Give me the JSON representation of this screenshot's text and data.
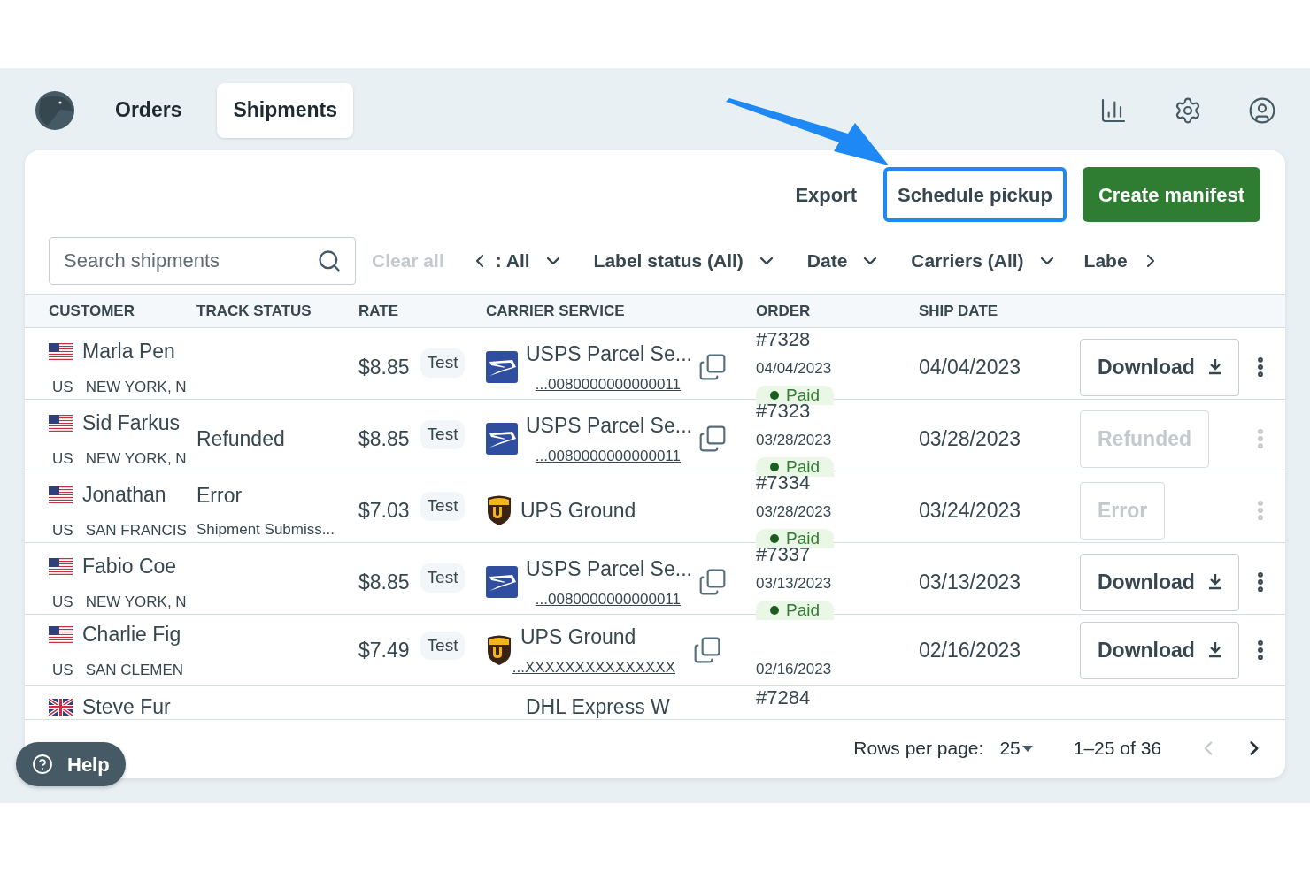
{
  "nav": {
    "tabs": [
      {
        "label": "Orders",
        "selected": false
      },
      {
        "label": "Shipments",
        "selected": true
      }
    ]
  },
  "toolbar": [
    {
      "label": "Export",
      "kind": "text",
      "highlighted": false
    },
    {
      "label": "Schedule pickup",
      "kind": "text",
      "highlighted": true
    },
    {
      "label": "Create manifest",
      "kind": "primary",
      "highlighted": false
    }
  ],
  "filters": {
    "search": {
      "placeholder": "Search shipments"
    },
    "clear_all": {
      "label": "Clear all",
      "disabled": true
    },
    "chips": [
      ": All",
      "Label status (All)",
      "Date",
      "Carriers (All)"
    ],
    "cut_chip": "Labe"
  },
  "table": {
    "columns": [
      "CUSTOMER",
      "TRACK STATUS",
      "RATE",
      "CARRIER SERVICE",
      "ORDER",
      "SHIP DATE"
    ],
    "rows": [
      {
        "flag": {
          "kind": "us"
        },
        "name": "Marla Pen",
        "country": "US",
        "city": "NEW YORK, N",
        "track_status": "",
        "track_detail": "",
        "rate": "$8.85",
        "rate_tag": "Test",
        "carrier": {
          "kind": "usps"
        },
        "service": "USPS Parcel Se...",
        "tracking": "...0080000000000011",
        "order": "#7328",
        "order_date": "04/04/2023",
        "payment": "Paid",
        "ship_date": "04/04/2023",
        "action": {
          "label": "Download",
          "disabled": false
        }
      },
      {
        "flag": {
          "kind": "us"
        },
        "name": "Sid Farkus",
        "country": "US",
        "city": "NEW YORK, N",
        "track_status": "Refunded",
        "track_detail": "",
        "rate": "$8.85",
        "rate_tag": "Test",
        "carrier": {
          "kind": "usps"
        },
        "service": "USPS Parcel Se...",
        "tracking": "...0080000000000011",
        "order": "#7323",
        "order_date": "03/28/2023",
        "payment": "Paid",
        "ship_date": "03/28/2023",
        "action": {
          "label": "Refunded",
          "disabled": true
        }
      },
      {
        "flag": {
          "kind": "us"
        },
        "name": "Jonathan",
        "country": "US",
        "city": "SAN FRANCIS",
        "track_status": "Error",
        "track_detail": "Shipment Submiss...",
        "rate": "$7.03",
        "rate_tag": "Test",
        "carrier": {
          "kind": "ups"
        },
        "service": "UPS Ground",
        "tracking": "",
        "order": "#7334",
        "order_date": "03/28/2023",
        "payment": "Paid",
        "ship_date": "03/24/2023",
        "action": {
          "label": "Error",
          "disabled": true
        }
      },
      {
        "flag": {
          "kind": "us"
        },
        "name": "Fabio Coe",
        "country": "US",
        "city": "NEW YORK, N",
        "track_status": "",
        "track_detail": "",
        "rate": "$8.85",
        "rate_tag": "Test",
        "carrier": {
          "kind": "usps"
        },
        "service": "USPS Parcel Se...",
        "tracking": "...0080000000000011",
        "order": "#7337",
        "order_date": "03/13/2023",
        "payment": "Paid",
        "ship_date": "03/13/2023",
        "action": {
          "label": "Download",
          "disabled": false
        }
      },
      {
        "flag": {
          "kind": "us"
        },
        "name": "Charlie Fig",
        "country": "US",
        "city": "SAN CLEMEN",
        "track_status": "",
        "track_detail": "",
        "rate": "$7.49",
        "rate_tag": "Test",
        "carrier": {
          "kind": "ups"
        },
        "service": "UPS Ground",
        "tracking": "...XXXXXXXXXXXXXXX",
        "order": "",
        "order_date": "02/16/2023",
        "payment": "",
        "ship_date": "02/16/2023",
        "action": {
          "label": "Download",
          "disabled": false
        }
      }
    ],
    "partial_row": {
      "flag": {
        "kind": "uk"
      },
      "name": "Steve Fur",
      "service": "DHL Express W",
      "order": "#7284"
    }
  },
  "pagination": {
    "rows_per_page_label": "Rows per page:",
    "rows_per_page": "25",
    "range": "1–25 of 36",
    "prev_disabled": true,
    "next_disabled": false
  },
  "help": {
    "label": "Help"
  }
}
